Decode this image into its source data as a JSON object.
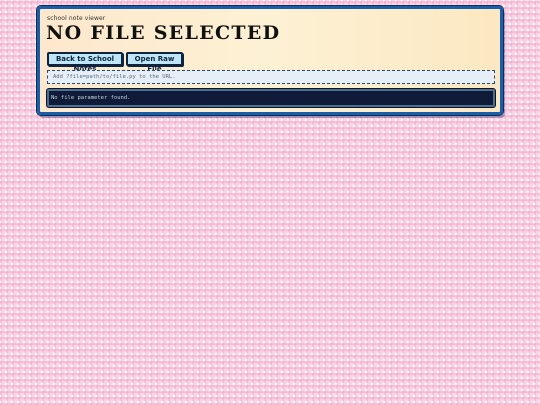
{
  "viewer": {
    "eyebrow": "school note viewer",
    "title": "NO FILE SELECTED",
    "buttons": {
      "back": "Back to School Notes",
      "raw": "Open Raw File"
    },
    "hint": "Add ?file=path/to/file.py to the URL.",
    "message": "No file parameter found."
  },
  "colors": {
    "page_background": "#fbd3e6",
    "card_border": "#1a5da8",
    "button_fill": "#bfe6f7",
    "panel_background": "#0f1b38"
  }
}
